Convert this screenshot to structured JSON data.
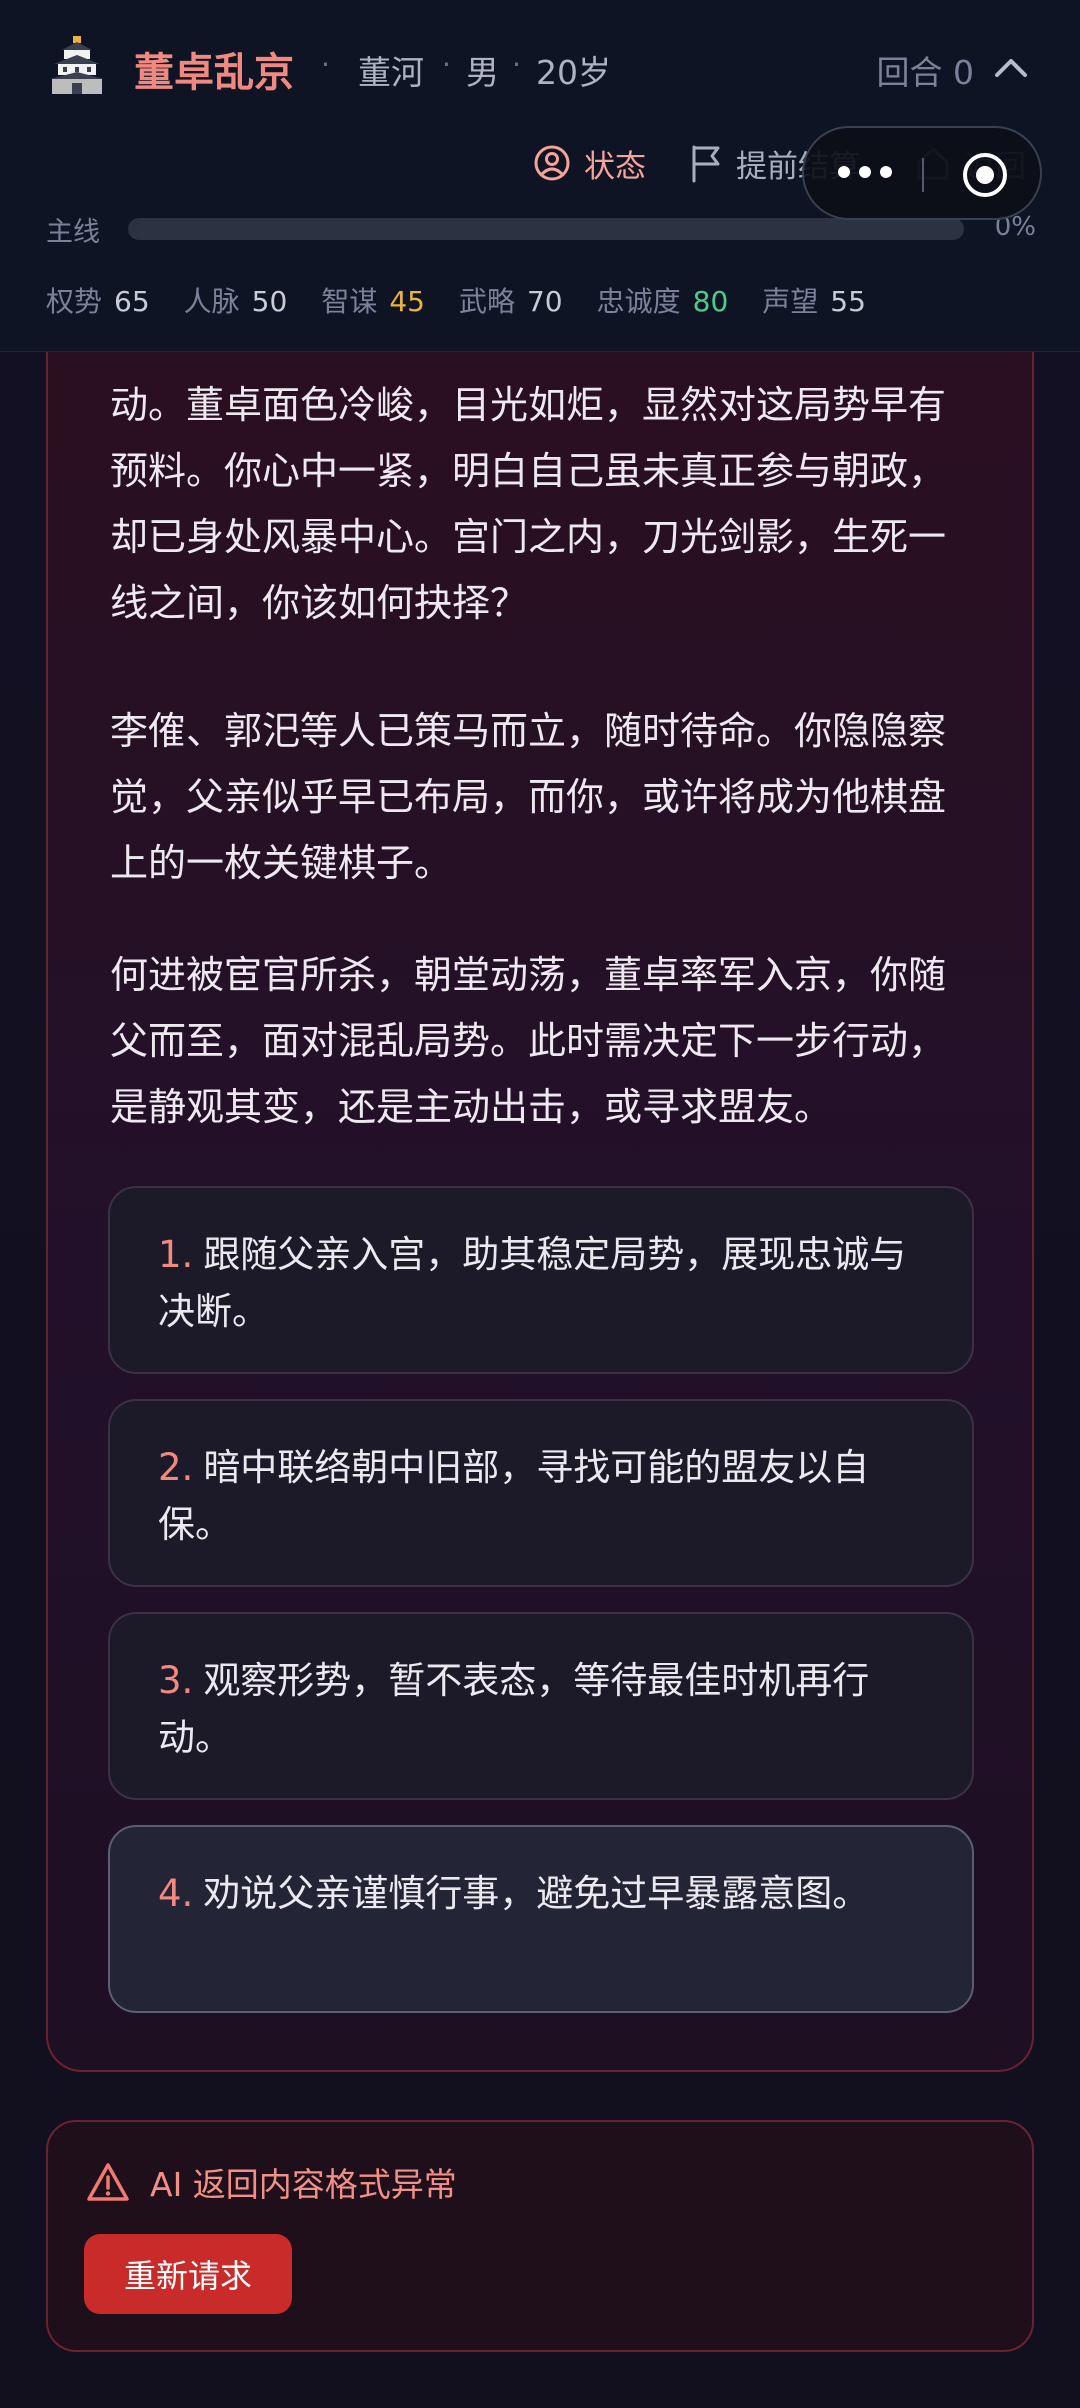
{
  "header": {
    "game_title": "董卓乱京",
    "separator": "·",
    "player_name": "董河",
    "player_gender": "男",
    "player_age": "20岁",
    "round_label": "回合 0",
    "actions": {
      "status": "状态",
      "end_early": "提前结算",
      "home": "返回"
    },
    "progress": {
      "label": "主线",
      "value_percent": 0,
      "display": "0%"
    },
    "stats": [
      {
        "label": "权势",
        "value": "65",
        "tone": "normal"
      },
      {
        "label": "人脉",
        "value": "50",
        "tone": "normal"
      },
      {
        "label": "智谋",
        "value": "45",
        "tone": "yellow"
      },
      {
        "label": "武略",
        "value": "70",
        "tone": "normal"
      },
      {
        "label": "忠诚度",
        "value": "80",
        "tone": "green"
      },
      {
        "label": "声望",
        "value": "55",
        "tone": "normal"
      }
    ]
  },
  "story": {
    "paragraphs": [
      "动。董卓面色冷峻，目光如炬，显然对这局势早有预料。你心中一紧，明白自己虽未真正参与朝政，却已身处风暴中心。宫门之内，刀光剑影，生死一线之间，你该如何抉择？",
      "李傕、郭汜等人已策马而立，随时待命。你隐隐察觉，父亲似乎早已布局，而你，或许将成为他棋盘上的一枚关键棋子。",
      "何进被宦官所杀，朝堂动荡，董卓率军入京，你随父而至，面对混乱局势。此时需决定下一步行动，是静观其变，还是主动出击，或寻求盟友。"
    ],
    "choices": [
      {
        "num": "1.",
        "text": "跟随父亲入宫，助其稳定局势，展现忠诚与决断。"
      },
      {
        "num": "2.",
        "text": "暗中联络朝中旧部，寻找可能的盟友以自保。"
      },
      {
        "num": "3.",
        "text": "观察形势，暂不表态，等待最佳时机再行动。"
      },
      {
        "num": "4.",
        "text": "劝说父亲谨慎行事，避免过早暴露意图。"
      }
    ]
  },
  "error": {
    "message": "AI 返回内容格式异常",
    "retry_label": "重新请求"
  },
  "colors": {
    "accent": "#f08a80",
    "danger_button": "#c92a2a",
    "stat_yellow": "#e8b340",
    "stat_green": "#4ecb8a"
  },
  "icons": [
    "castle-logo-icon",
    "chevron-up-icon",
    "user-circle-icon",
    "flag-icon",
    "home-icon",
    "more-dots-icon",
    "target-icon",
    "warning-triangle-icon"
  ]
}
